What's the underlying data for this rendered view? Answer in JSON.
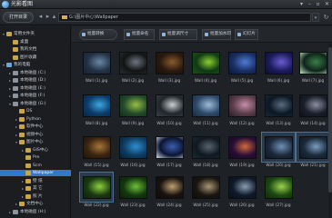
{
  "window": {
    "title": "光影看图",
    "buttons": [
      "▾",
      "–",
      "▫",
      "✕"
    ]
  },
  "toolbar": {
    "open_dir_label": "打开目录",
    "back": "◂",
    "forward": "▸",
    "up": "▴",
    "path": "G:\\图片中心\\Wallpaper",
    "dropdown": "▾",
    "refresh": "↻"
  },
  "sidebar": {
    "items": [
      {
        "label": "常用文件夹",
        "expander": "▾",
        "icon": "folder",
        "indent": 0
      },
      {
        "label": "桌面",
        "expander": "",
        "icon": "folder",
        "indent": 1
      },
      {
        "label": "我的文档",
        "expander": "",
        "icon": "folder",
        "indent": 1
      },
      {
        "label": "图片收藏",
        "expander": "",
        "icon": "folder",
        "indent": 1
      },
      {
        "label": "我的电脑",
        "expander": "▾",
        "icon": "pc",
        "indent": 0
      },
      {
        "label": "本地磁盘 (C:)",
        "expander": "▸",
        "icon": "drive",
        "indent": 1
      },
      {
        "label": "本地磁盘 (D:)",
        "expander": "▸",
        "icon": "drive",
        "indent": 1
      },
      {
        "label": "本地磁盘 (E:)",
        "expander": "▸",
        "icon": "drive",
        "indent": 1
      },
      {
        "label": "本地磁盘 (F:)",
        "expander": "▸",
        "icon": "drive",
        "indent": 1
      },
      {
        "label": "本地磁盘 (G:)",
        "expander": "▾",
        "icon": "drive",
        "indent": 1
      },
      {
        "label": "DS",
        "expander": "",
        "icon": "folder",
        "indent": 2
      },
      {
        "label": "Python",
        "expander": "▸",
        "icon": "folder",
        "indent": 2
      },
      {
        "label": "软件中心",
        "expander": "▸",
        "icon": "folder",
        "indent": 2
      },
      {
        "label": "视频中心",
        "expander": "▸",
        "icon": "folder",
        "indent": 2
      },
      {
        "label": "图片中心",
        "expander": "▾",
        "icon": "folder",
        "indent": 2
      },
      {
        "label": "GIS中心",
        "expander": "▸",
        "icon": "folder",
        "indent": 3
      },
      {
        "label": "Pre",
        "expander": "",
        "icon": "folder",
        "indent": 3
      },
      {
        "label": "Scm",
        "expander": "",
        "icon": "folder",
        "indent": 3
      },
      {
        "label": "Wallpaper",
        "expander": "",
        "icon": "folder",
        "indent": 3,
        "selected": true
      },
      {
        "label": "壁 纸",
        "expander": "▸",
        "icon": "folder",
        "indent": 3
      },
      {
        "label": "其 它",
        "expander": "▸",
        "icon": "folder",
        "indent": 3
      },
      {
        "label": "照 片",
        "expander": "▸",
        "icon": "folder",
        "indent": 3
      },
      {
        "label": "文档中心",
        "expander": "▸",
        "icon": "folder",
        "indent": 2
      },
      {
        "label": "本地磁盘 (H:)",
        "expander": "▸",
        "icon": "drive",
        "indent": 1
      }
    ]
  },
  "actionbar": {
    "buttons": [
      {
        "name": "batch-convert-button",
        "label": "批量转换"
      },
      {
        "name": "batch-rename-button",
        "label": "批量命名"
      },
      {
        "name": "batch-resize-button",
        "label": "批量调尺寸"
      },
      {
        "name": "batch-watermark-button",
        "label": "批量加水印"
      },
      {
        "name": "slideshow-button",
        "label": "幻灯片"
      }
    ]
  },
  "gallery": {
    "thumbnails": [
      {
        "file": "Wall (1).jpg",
        "colors": [
          "#233245",
          "#6b87a6",
          "#1a2230"
        ]
      },
      {
        "file": "Wall (2).jpg",
        "colors": [
          "#121414",
          "#6d7680",
          "#2a2e33"
        ]
      },
      {
        "file": "Wall (3).jpg",
        "colors": [
          "#2a1a10",
          "#8a5a2b",
          "#1a120b"
        ]
      },
      {
        "file": "Wall (4).jpg",
        "colors": [
          "#0f3a14",
          "#8ccf2f",
          "#21501a"
        ]
      },
      {
        "file": "Wall (5).jpg",
        "colors": [
          "#1a2f63",
          "#4d7cd6",
          "#0b1838"
        ]
      },
      {
        "file": "Wall (6).jpg",
        "colors": [
          "#1c1c5e",
          "#6a5cd2",
          "#0d0d2e"
        ]
      },
      {
        "file": "Wall (7).jpg",
        "colors": [
          "#0e2418",
          "#3a7d4b",
          "#c7e8cd"
        ]
      },
      {
        "file": "Wall (8).jpg",
        "colors": [
          "#0c3c6b",
          "#3ca8e0",
          "#0a2541"
        ]
      },
      {
        "file": "Wall (9).jpg",
        "colors": [
          "#234c2a",
          "#97bf45",
          "#132b17"
        ]
      },
      {
        "file": "Wall (10).jpg",
        "colors": [
          "#20262a",
          "#c9cfd3",
          "#3a4046"
        ]
      },
      {
        "file": "Wall (11).jpg",
        "colors": [
          "#2d4a6b",
          "#9fbcd8",
          "#1b2b3e"
        ]
      },
      {
        "file": "Wall (12).jpg",
        "colors": [
          "#5a3e4a",
          "#c58da6",
          "#2b1e25"
        ]
      },
      {
        "file": "Wall (13).jpg",
        "colors": [
          "#0b1824",
          "#5a6b80",
          "#1b2835"
        ]
      },
      {
        "file": "Wall (14).jpg",
        "colors": [
          "#1a1f2a",
          "#8b8fa3",
          "#0e1118"
        ]
      },
      {
        "file": "Wall (15).jpg",
        "colors": [
          "#3a2512",
          "#a87538",
          "#1e1309"
        ]
      },
      {
        "file": "Wall (16).jpg",
        "colors": [
          "#0e3d63",
          "#2f8fd0",
          "#072033"
        ]
      },
      {
        "file": "Wall (17).jpg",
        "colors": [
          "#0a1430",
          "#3c5fb0",
          "#d2dbe8"
        ]
      },
      {
        "file": "Wall (18).jpg",
        "colors": [
          "#101820",
          "#55636f",
          "#1e2a33"
        ]
      },
      {
        "file": "Wall (19).jpg",
        "colors": [
          "#2a0f36",
          "#d16a3a",
          "#160820"
        ]
      },
      {
        "file": "Wall (20).jpg",
        "colors": [
          "#1d2a3b",
          "#6f93b9",
          "#0f1720"
        ],
        "selected": true
      },
      {
        "file": "Wall (21).jpg",
        "colors": [
          "#1b2a3a",
          "#7b9dc0",
          "#0e1720"
        ],
        "selected": true
      },
      {
        "file": "Wall (22).jpg",
        "colors": [
          "#1a3a10",
          "#8dd040",
          "#0f2108"
        ],
        "selected": true
      },
      {
        "file": "Wall (23).jpg",
        "colors": [
          "#14380f",
          "#6cc037",
          "#0c1f08"
        ]
      },
      {
        "file": "Wall (24).jpg",
        "colors": [
          "#1a1410",
          "#c0a070",
          "#0c0a08"
        ]
      },
      {
        "file": "Wall (25).jpg",
        "colors": [
          "#1b1612",
          "#a99674",
          "#0d0b09"
        ]
      },
      {
        "file": "Wall (26).jpg",
        "colors": [
          "#0f1a2a",
          "#8a9cb0",
          "#0a1018"
        ]
      },
      {
        "file": "Wall (27).jpg",
        "colors": [
          "#1c4a12",
          "#9fd24c",
          "#0f280a"
        ]
      }
    ]
  }
}
